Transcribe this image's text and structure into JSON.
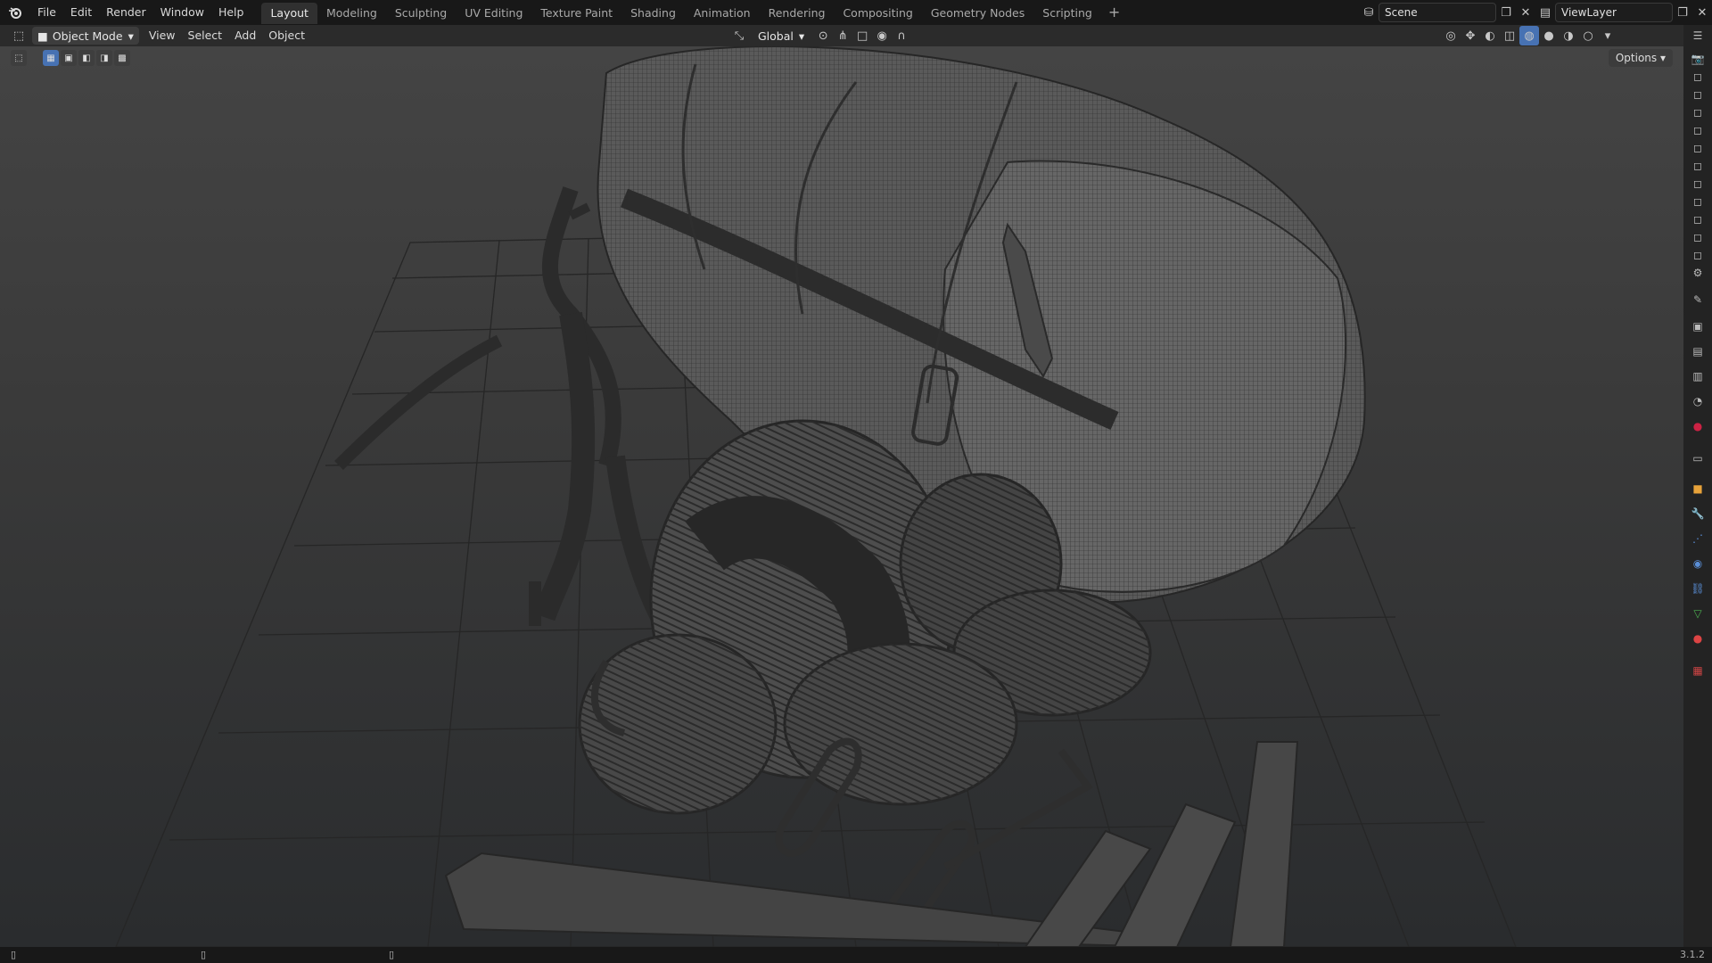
{
  "menu": [
    "File",
    "Edit",
    "Render",
    "Window",
    "Help"
  ],
  "workspace_tabs": [
    {
      "label": "Layout",
      "active": true
    },
    {
      "label": "Modeling",
      "active": false
    },
    {
      "label": "Sculpting",
      "active": false
    },
    {
      "label": "UV Editing",
      "active": false
    },
    {
      "label": "Texture Paint",
      "active": false
    },
    {
      "label": "Shading",
      "active": false
    },
    {
      "label": "Animation",
      "active": false
    },
    {
      "label": "Rendering",
      "active": false
    },
    {
      "label": "Compositing",
      "active": false
    },
    {
      "label": "Geometry Nodes",
      "active": false
    },
    {
      "label": "Scripting",
      "active": false
    }
  ],
  "tab_add": "+",
  "scene": {
    "name": "Scene"
  },
  "view_layer": {
    "name": "ViewLayer"
  },
  "header": {
    "mode": "Object Mode",
    "items": [
      "View",
      "Select",
      "Add",
      "Object"
    ],
    "transform_orientation": "Global",
    "options": "Options"
  },
  "status": {
    "version": "3.1.2"
  },
  "colors": {
    "accent": "#4772b3",
    "active_tab": "#303030"
  },
  "icons": {
    "logo": "blender-logo",
    "right_column": [
      "render-icon",
      "output-icon",
      "view-layer-icon",
      "scene-icon",
      "world-icon",
      "collection-icon",
      "object-icon",
      "modifier-icon",
      "particles-icon",
      "physics-icon",
      "constraints-icon",
      "data-icon",
      "material-icon",
      "texture-icon"
    ]
  }
}
